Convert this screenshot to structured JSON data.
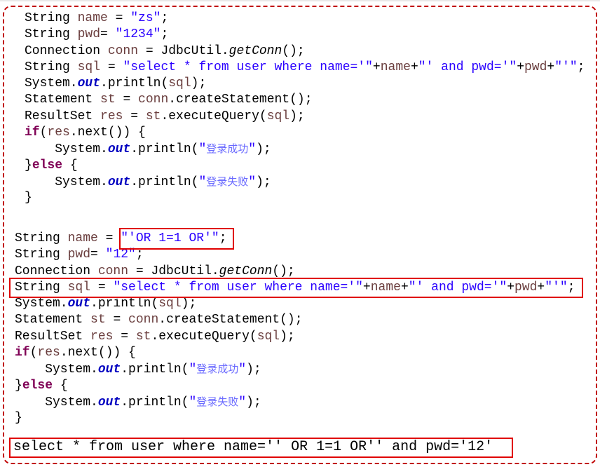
{
  "colors": {
    "frame": "#c00000",
    "highlight": "#e00000",
    "keyword": "#7f0055",
    "string": "#2a00ff",
    "variable": "#6a3e3e",
    "field": "#0000c0"
  },
  "block1": [
    [
      [
        "String ",
        "plain"
      ],
      [
        "name",
        "var"
      ],
      [
        " = ",
        "plain"
      ],
      [
        "\"zs\"",
        "str"
      ],
      [
        ";",
        "plain"
      ]
    ],
    [
      [
        "String ",
        "plain"
      ],
      [
        "pwd",
        "var"
      ],
      [
        "= ",
        "plain"
      ],
      [
        "\"1234\"",
        "str"
      ],
      [
        ";",
        "plain"
      ]
    ],
    [
      [
        "Connection ",
        "plain"
      ],
      [
        "conn",
        "var"
      ],
      [
        " = JdbcUtil.",
        "plain"
      ],
      [
        "getConn",
        "ital"
      ],
      [
        "();",
        "plain"
      ]
    ],
    [
      [
        "String ",
        "plain"
      ],
      [
        "sql",
        "var"
      ],
      [
        " = ",
        "plain"
      ],
      [
        "\"select * from user where name='\"",
        "str"
      ],
      [
        "+",
        "plain"
      ],
      [
        "name",
        "var"
      ],
      [
        "+",
        "plain"
      ],
      [
        "\"' and pwd='\"",
        "str"
      ],
      [
        "+",
        "plain"
      ],
      [
        "pwd",
        "var"
      ],
      [
        "+",
        "plain"
      ],
      [
        "\"'\"",
        "str"
      ],
      [
        ";",
        "plain"
      ]
    ],
    [
      [
        "System.",
        "plain"
      ],
      [
        "out",
        "field"
      ],
      [
        ".println(",
        "plain"
      ],
      [
        "sql",
        "var"
      ],
      [
        ");",
        "plain"
      ]
    ],
    [
      [
        "Statement ",
        "plain"
      ],
      [
        "st",
        "var"
      ],
      [
        " = ",
        "plain"
      ],
      [
        "conn",
        "var"
      ],
      [
        ".createStatement();",
        "plain"
      ]
    ],
    [
      [
        "ResultSet ",
        "plain"
      ],
      [
        "res",
        "var"
      ],
      [
        " = ",
        "plain"
      ],
      [
        "st",
        "var"
      ],
      [
        ".executeQuery(",
        "plain"
      ],
      [
        "sql",
        "var"
      ],
      [
        ");",
        "plain"
      ]
    ],
    [
      [
        "if",
        "kw"
      ],
      [
        "(",
        "plain"
      ],
      [
        "res",
        "var"
      ],
      [
        ".next()) {",
        "plain"
      ]
    ],
    [
      [
        "    System.",
        "plain"
      ],
      [
        "out",
        "field"
      ],
      [
        ".println(",
        "plain"
      ],
      [
        "\"",
        "str"
      ],
      [
        "登录成功",
        "cn"
      ],
      [
        "\"",
        "str"
      ],
      [
        ");",
        "plain"
      ]
    ],
    [
      [
        "}",
        "plain"
      ],
      [
        "else",
        "kw"
      ],
      [
        " {",
        "plain"
      ]
    ],
    [
      [
        "    System.",
        "plain"
      ],
      [
        "out",
        "field"
      ],
      [
        ".println(",
        "plain"
      ],
      [
        "\"",
        "str"
      ],
      [
        "登录失败",
        "cn"
      ],
      [
        "\"",
        "str"
      ],
      [
        ");",
        "plain"
      ]
    ],
    [
      [
        "}",
        "plain"
      ]
    ]
  ],
  "block2": [
    [
      [
        "String ",
        "plain"
      ],
      [
        "name",
        "var"
      ],
      [
        " = ",
        "plain"
      ],
      [
        "\"'OR 1=1 OR'\"",
        "str"
      ],
      [
        ";",
        "plain"
      ]
    ],
    [
      [
        "String ",
        "plain"
      ],
      [
        "pwd",
        "var"
      ],
      [
        "= ",
        "plain"
      ],
      [
        "\"12\"",
        "str"
      ],
      [
        ";",
        "plain"
      ]
    ],
    [
      [
        "Connection ",
        "plain"
      ],
      [
        "conn",
        "var"
      ],
      [
        " = JdbcUtil.",
        "plain"
      ],
      [
        "getConn",
        "ital"
      ],
      [
        "();",
        "plain"
      ]
    ],
    [
      [
        "String ",
        "plain"
      ],
      [
        "sql",
        "var"
      ],
      [
        " = ",
        "plain"
      ],
      [
        "\"select * from user where name='\"",
        "str"
      ],
      [
        "+",
        "plain"
      ],
      [
        "name",
        "var"
      ],
      [
        "+",
        "plain"
      ],
      [
        "\"' and pwd='\"",
        "str"
      ],
      [
        "+",
        "plain"
      ],
      [
        "pwd",
        "var"
      ],
      [
        "+",
        "plain"
      ],
      [
        "\"'\"",
        "str"
      ],
      [
        ";",
        "plain"
      ]
    ],
    [
      [
        "System.",
        "plain"
      ],
      [
        "out",
        "field"
      ],
      [
        ".println(",
        "plain"
      ],
      [
        "sql",
        "var"
      ],
      [
        ");",
        "plain"
      ]
    ],
    [
      [
        "Statement ",
        "plain"
      ],
      [
        "st",
        "var"
      ],
      [
        " = ",
        "plain"
      ],
      [
        "conn",
        "var"
      ],
      [
        ".createStatement();",
        "plain"
      ]
    ],
    [
      [
        "ResultSet ",
        "plain"
      ],
      [
        "res",
        "var"
      ],
      [
        " = ",
        "plain"
      ],
      [
        "st",
        "var"
      ],
      [
        ".executeQuery(",
        "plain"
      ],
      [
        "sql",
        "var"
      ],
      [
        ");",
        "plain"
      ]
    ],
    [
      [
        "if",
        "kw"
      ],
      [
        "(",
        "plain"
      ],
      [
        "res",
        "var"
      ],
      [
        ".next()) {",
        "plain"
      ]
    ],
    [
      [
        "    System.",
        "plain"
      ],
      [
        "out",
        "field"
      ],
      [
        ".println(",
        "plain"
      ],
      [
        "\"",
        "str"
      ],
      [
        "登录成功",
        "cn"
      ],
      [
        "\"",
        "str"
      ],
      [
        ");",
        "plain"
      ]
    ],
    [
      [
        "}",
        "plain"
      ],
      [
        "else",
        "kw"
      ],
      [
        " {",
        "plain"
      ]
    ],
    [
      [
        "    System.",
        "plain"
      ],
      [
        "out",
        "field"
      ],
      [
        ".println(",
        "plain"
      ],
      [
        "\"",
        "str"
      ],
      [
        "登录失败",
        "cn"
      ],
      [
        "\"",
        "str"
      ],
      [
        ");",
        "plain"
      ]
    ],
    [
      [
        "}",
        "plain"
      ]
    ]
  ],
  "query_output": "select * from user where name='' OR 1=1 OR'' and pwd='12'"
}
